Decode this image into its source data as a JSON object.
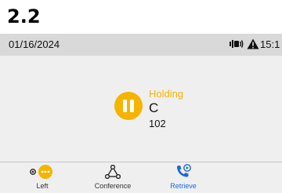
{
  "heading": "2.2",
  "statusbar": {
    "date": "01/16/2024",
    "time": "15:1",
    "icons": [
      "volume-vibrate-icon",
      "warning-icon"
    ]
  },
  "call": {
    "state": "Holding",
    "name": "C",
    "number": "102",
    "state_color": "#f5b400"
  },
  "softkeys": [
    {
      "label": "Left",
      "icon": "more-options-icon"
    },
    {
      "label": "Conference",
      "icon": "conference-icon"
    },
    {
      "label": "Retrieve",
      "icon": "retrieve-call-icon",
      "color": "#1a6ad4"
    }
  ]
}
